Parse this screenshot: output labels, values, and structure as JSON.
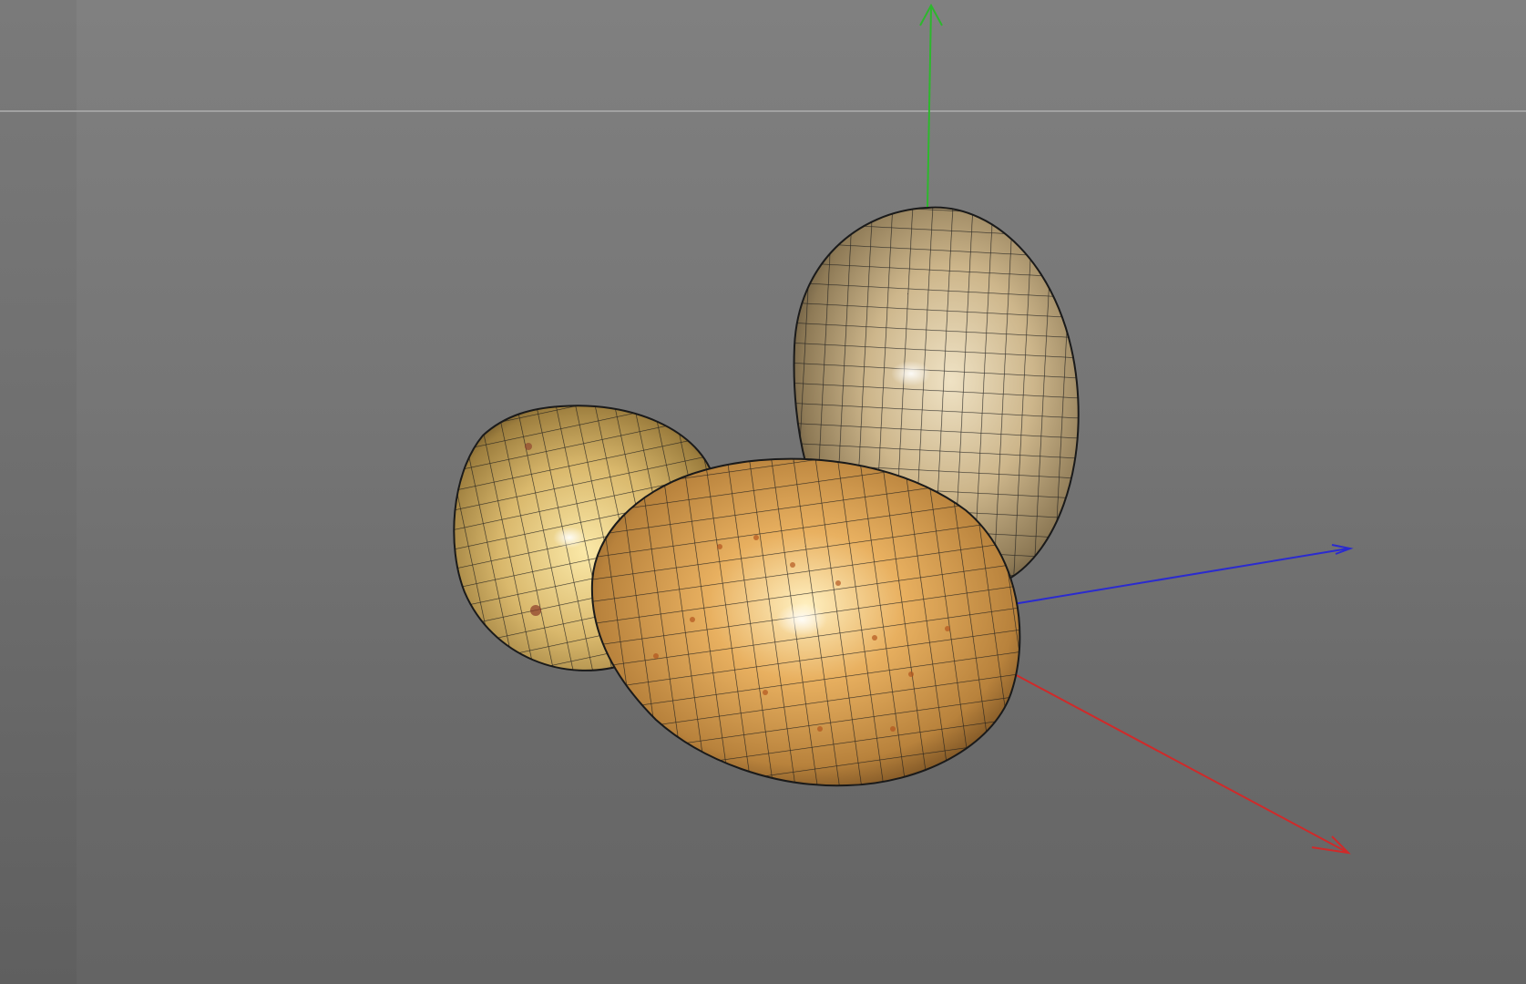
{
  "viewport": {
    "background_top": "#808080",
    "background_bottom": "#646464",
    "horizon_color": "#a8a8a8"
  },
  "axes": {
    "y_color": "#2db82d",
    "z_color": "#2a2ad0",
    "x_color": "#d02a2a"
  },
  "objects": {
    "count": 3,
    "material": "potato-texture",
    "wireframe_color": "#1a1a1a"
  }
}
